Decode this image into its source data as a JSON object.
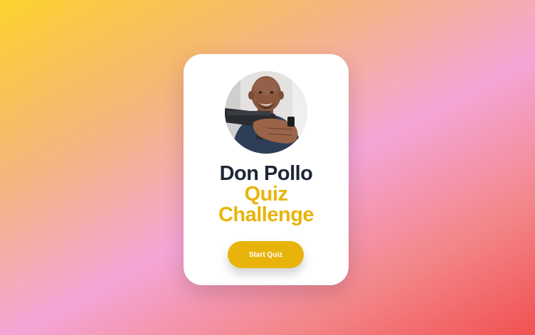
{
  "card": {
    "avatar_alt": "Don Pollo portrait",
    "title_line1": "Don Pollo",
    "title_line2": "Quiz",
    "title_line3": "Challenge",
    "start_label": "Start Quiz"
  },
  "colors": {
    "accent": "#e8b40c",
    "title_dark": "#1e2736",
    "card_bg": "#ffffff"
  }
}
